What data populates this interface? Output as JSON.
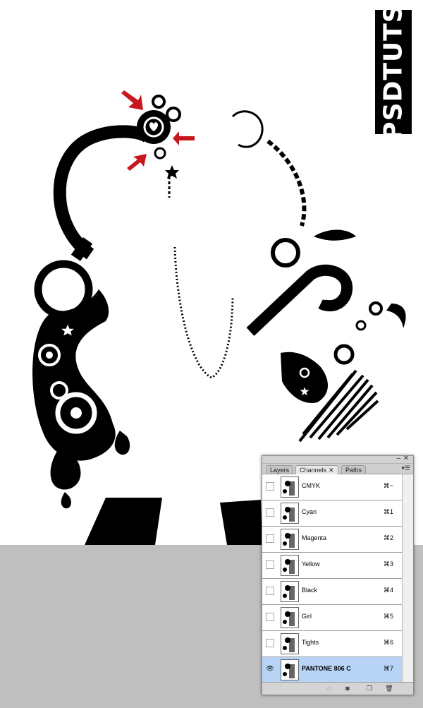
{
  "badge": {
    "text": "PSDTUTS"
  },
  "panel": {
    "tabs": [
      {
        "label": "Layers",
        "active": false
      },
      {
        "label": "Channels",
        "active": true
      },
      {
        "label": "Paths",
        "active": false
      }
    ],
    "channels": [
      {
        "name": "CMYK",
        "shortcut": "⌘~",
        "selected": false,
        "visible": false
      },
      {
        "name": "Cyan",
        "shortcut": "⌘1",
        "selected": false,
        "visible": false
      },
      {
        "name": "Magenta",
        "shortcut": "⌘2",
        "selected": false,
        "visible": false
      },
      {
        "name": "Yellow",
        "shortcut": "⌘3",
        "selected": false,
        "visible": false
      },
      {
        "name": "Black",
        "shortcut": "⌘4",
        "selected": false,
        "visible": false
      },
      {
        "name": "Girl",
        "shortcut": "⌘5",
        "selected": false,
        "visible": false
      },
      {
        "name": "Tights",
        "shortcut": "⌘6",
        "selected": false,
        "visible": false
      },
      {
        "name": "PANTONE 806 C",
        "shortcut": "⌘7",
        "selected": true,
        "visible": true
      }
    ]
  },
  "colors": {
    "arrow": "#c8161d",
    "ink": "#000000",
    "gray": "#bfbfbf",
    "selection": "#b7d4f7"
  }
}
